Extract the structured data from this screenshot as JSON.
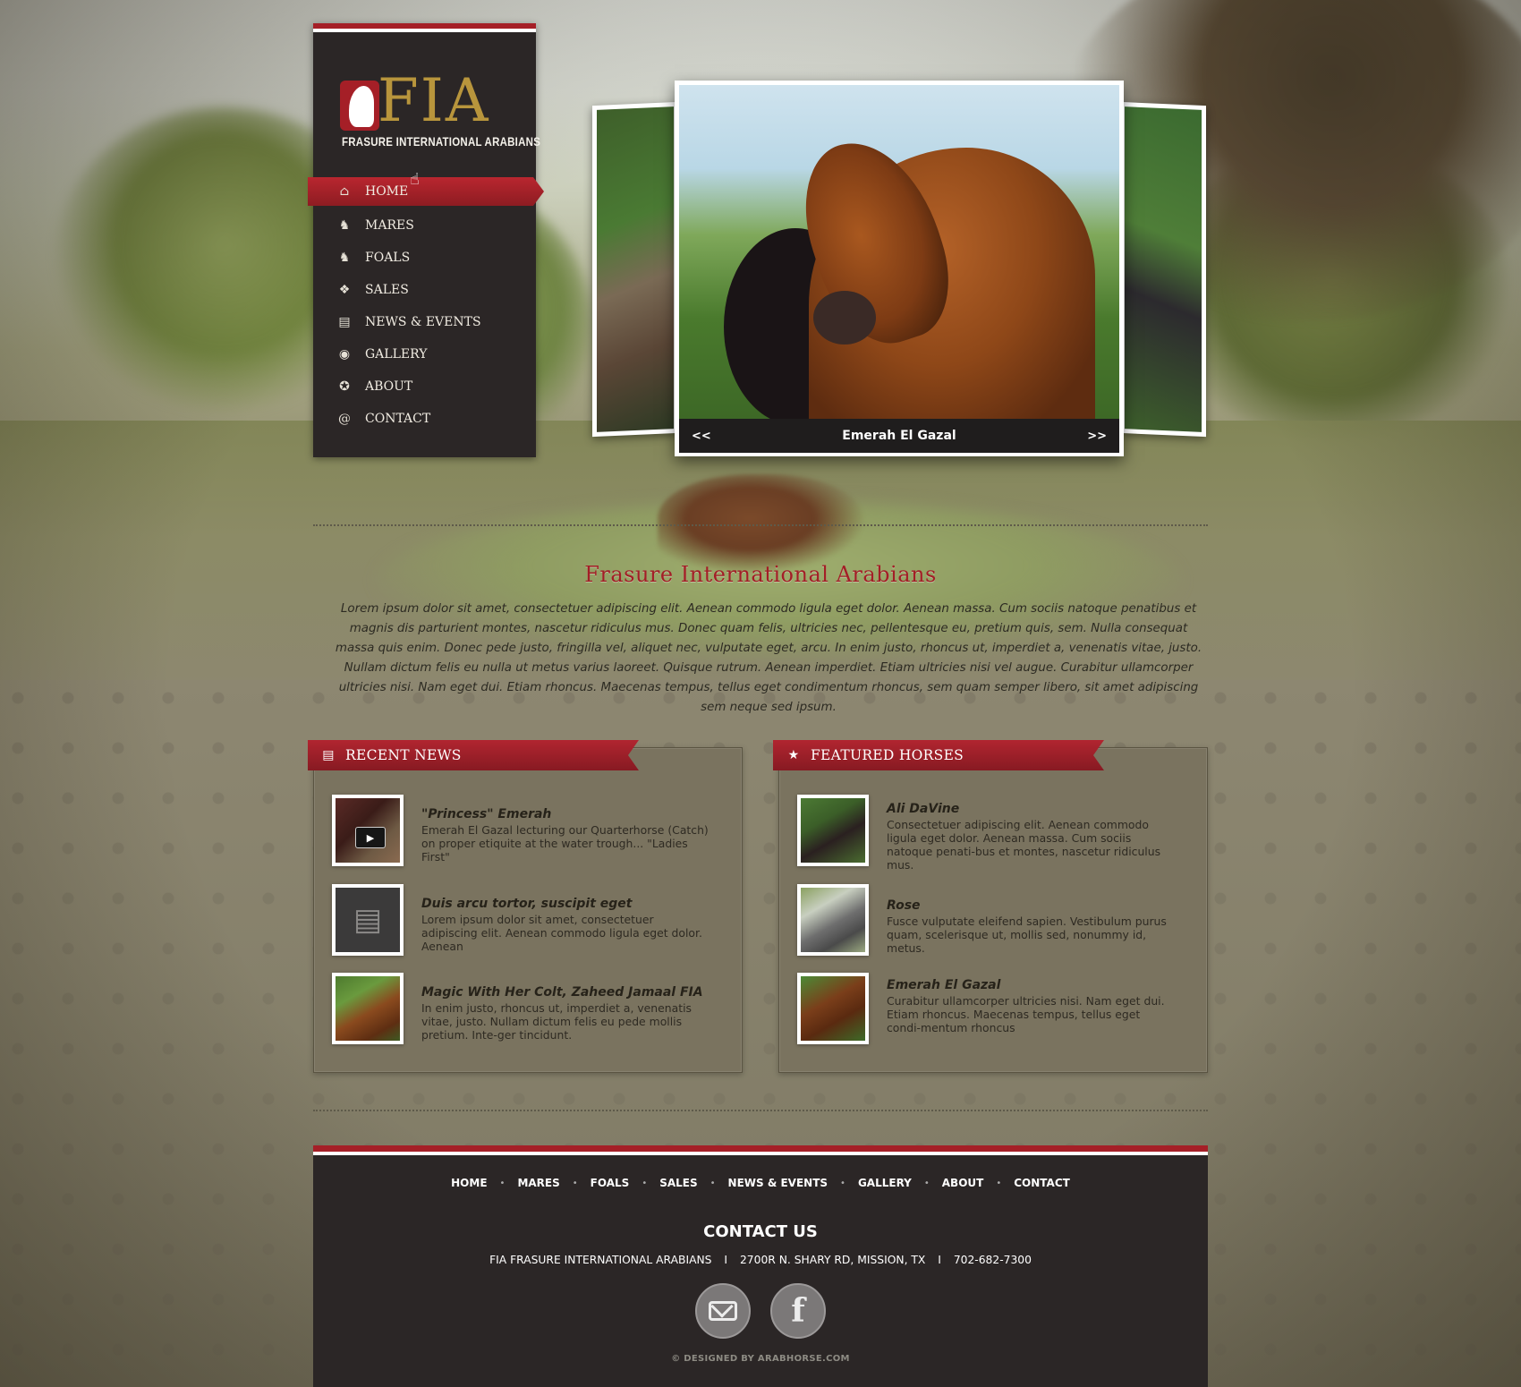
{
  "site": {
    "logo_text": "FIA",
    "logo_subtitle": "FRASURE INTERNATIONAL ARABIANS"
  },
  "nav": {
    "items": [
      {
        "label": "HOME",
        "icon": "home-icon",
        "active": true
      },
      {
        "label": "MARES",
        "icon": "horse-head-icon"
      },
      {
        "label": "FOALS",
        "icon": "horse-head-icon"
      },
      {
        "label": "SALES",
        "icon": "tag-icon"
      },
      {
        "label": "NEWS & EVENTS",
        "icon": "newspaper-icon"
      },
      {
        "label": "GALLERY",
        "icon": "camera-icon"
      },
      {
        "label": "ABOUT",
        "icon": "star-circle-icon"
      },
      {
        "label": "CONTACT",
        "icon": "at-sign-icon"
      }
    ]
  },
  "slider": {
    "prev_label": "<<",
    "next_label": ">>",
    "caption": "Emerah El Gazal"
  },
  "intro": {
    "title": "Frasure International Arabians",
    "text": "Lorem ipsum dolor sit amet, consectetuer adipiscing elit. Aenean commodo ligula eget dolor. Aenean massa. Cum sociis natoque penatibus et magnis dis parturient montes, nascetur ridiculus mus. Donec quam felis, ultricies nec, pellentesque eu, pretium quis, sem. Nulla consequat massa quis enim. Donec pede justo, fringilla vel, aliquet nec, vulputate eget, arcu. In enim justo, rhoncus ut, imperdiet a, venenatis vitae, justo. Nullam dictum felis eu nulla ut metus varius laoreet. Quisque rutrum. Aenean imperdiet. Etiam ultricies nisi vel augue. Curabitur ullamcorper ultricies nisi. Nam eget dui. Etiam rhoncus. Maecenas tempus, tellus eget condimentum rhoncus, sem quam semper libero, sit amet adipiscing sem neque sed ipsum."
  },
  "recent_news": {
    "heading": "RECENT NEWS",
    "items": [
      {
        "title": "\"Princess\" Emerah",
        "desc": "Emerah El Gazal lecturing our Quarterhorse (Catch) on proper etiquite at the water trough... \"Ladies First\"",
        "thumb": "video"
      },
      {
        "title": "Duis arcu tortor, suscipit eget",
        "desc": "Lorem ipsum dolor sit amet, consectetuer adipiscing elit. Aenean commodo ligula eget dolor. Aenean",
        "thumb": "newspaper-icon"
      },
      {
        "title": "Magic With Her Colt, Zaheed Jamaal FIA",
        "desc": "In enim justo, rhoncus ut, imperdiet a, venenatis vitae, justo. Nullam dictum felis eu pede mollis pretium. Inte-ger tincidunt.",
        "thumb": "photo"
      }
    ]
  },
  "featured_horses": {
    "heading": "FEATURED HORSES",
    "items": [
      {
        "title": "Ali DaVine",
        "desc": "Consectetuer adipiscing elit. Aenean commodo ligula eget dolor. Aenean massa. Cum sociis natoque penati-bus et montes, nascetur ridiculus mus."
      },
      {
        "title": "Rose",
        "desc": "Fusce vulputate eleifend sapien. Vestibulum purus quam, scelerisque ut, mollis sed, nonummy id, metus."
      },
      {
        "title": "Emerah El Gazal",
        "desc": "Curabitur ullamcorper ultricies nisi. Nam eget dui. Etiam rhoncus. Maecenas tempus, tellus eget condi-mentum rhoncus"
      }
    ]
  },
  "footer": {
    "nav": [
      "HOME",
      "MARES",
      "FOALS",
      "SALES",
      "NEWS & EVENTS",
      "GALLERY",
      "ABOUT",
      "CONTACT"
    ],
    "contact_heading": "CONTACT US",
    "company": "FIA FRASURE INTERNATIONAL ARABIANS",
    "address": "2700R N. SHARY RD, MISSION, TX",
    "phone": "702-682-7300",
    "separator": "I",
    "credit": "© DESIGNED BY ARABHORSE.COM"
  },
  "colors": {
    "accent_red": "#a51f27",
    "panel_dark": "#2b2626",
    "logo_gold": "#b8953c",
    "box_bg": "#7a735f"
  }
}
